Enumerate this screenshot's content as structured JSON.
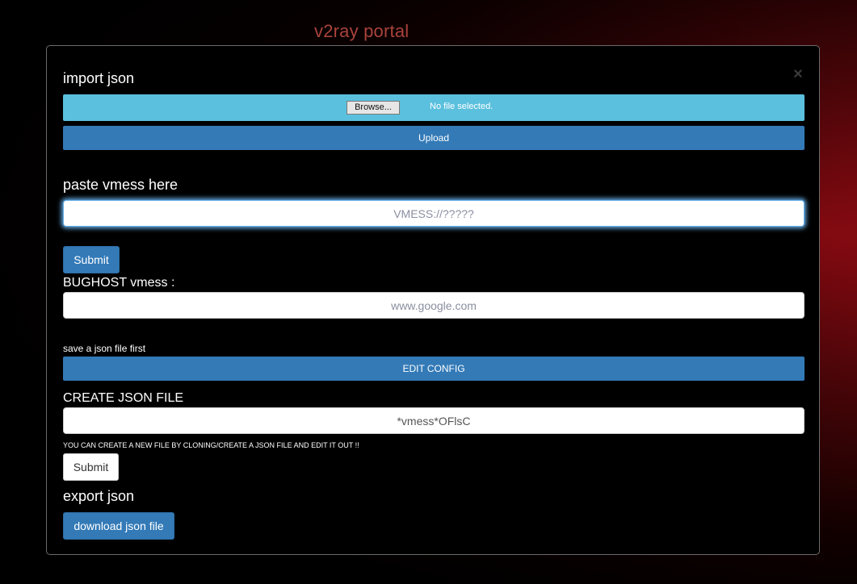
{
  "page": {
    "title": "v2ray portal"
  },
  "import": {
    "heading": "import json",
    "browse_label": "Browse...",
    "file_status": "No file selected.",
    "upload_label": "Upload",
    "close_icon": "×"
  },
  "vmess": {
    "heading": "paste vmess here",
    "placeholder": "VMESS://?????",
    "submit_label": "Submit"
  },
  "bughost": {
    "label": "BUGHOST vmess :",
    "placeholder": "www.google.com"
  },
  "config": {
    "note": "save a json file first",
    "edit_label": "EDIT CONFIG"
  },
  "create": {
    "heading": "CREATE JSON FILE",
    "value": "*vmess*OFlsC",
    "hint": "YOU CAN CREATE A NEW FILE BY CLONING/CREATE A JSON FILE AND EDIT IT OUT !!",
    "submit_label": "Submit"
  },
  "export": {
    "heading": "export json",
    "download_label": "download json file"
  },
  "colors": {
    "info_blue": "#5bc0de",
    "primary_blue": "#337ab7",
    "title_red": "#a9433b"
  }
}
